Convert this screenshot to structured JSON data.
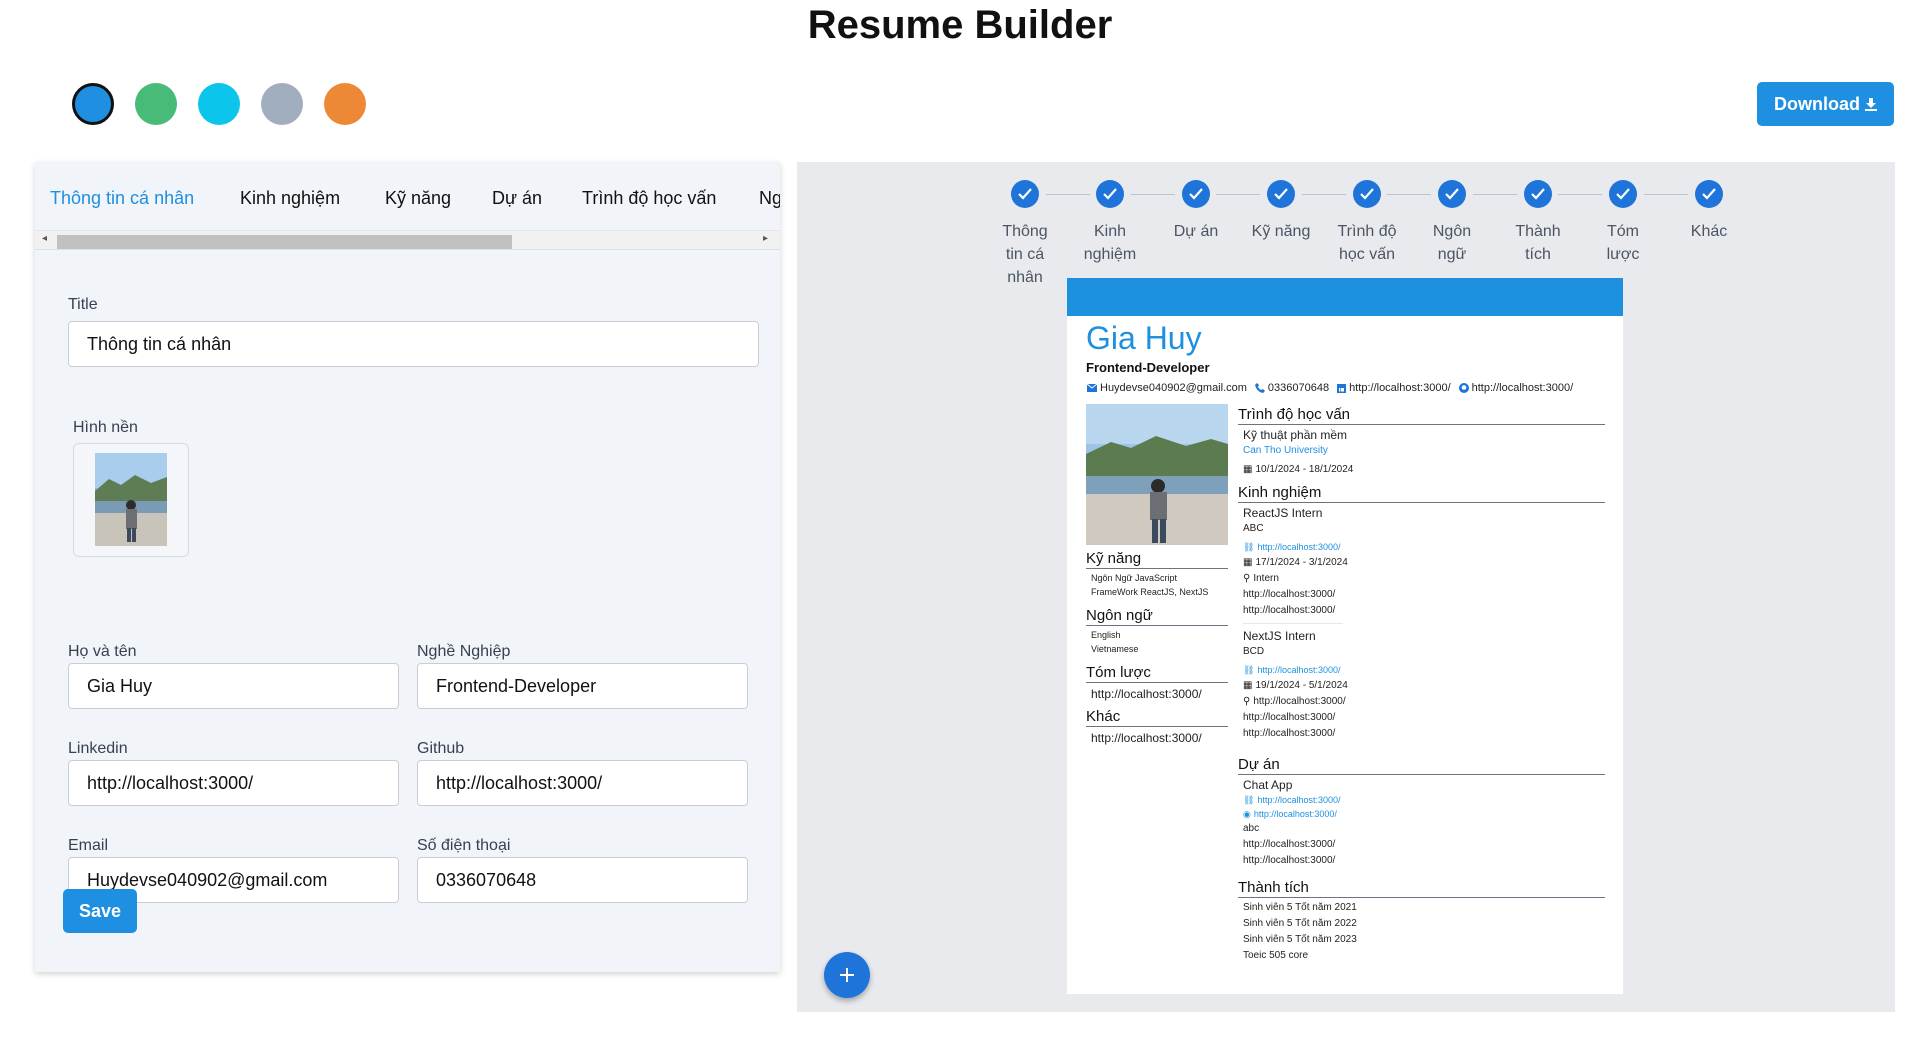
{
  "app": {
    "title": "Resume Builder",
    "download_label": "Download"
  },
  "colors": {
    "swatches": [
      "#1e8fe1",
      "#48bb78",
      "#0bc5ea",
      "#a0aec0",
      "#ed8936"
    ],
    "selected_swatch": "#1e8fe1",
    "accent": "#1e8fe1"
  },
  "tabs": [
    {
      "label": "Thông tin cá nhân",
      "active": true
    },
    {
      "label": "Kinh nghiệm",
      "active": false
    },
    {
      "label": "Kỹ năng",
      "active": false
    },
    {
      "label": "Dự án",
      "active": false
    },
    {
      "label": "Trình độ học vấn",
      "active": false
    },
    {
      "label": "Ng",
      "active": false
    }
  ],
  "form": {
    "title_label": "Title",
    "title_value": "Thông tin cá nhân",
    "background_label": "Hình nền",
    "fullname_label": "Họ và tên",
    "fullname_value": "Gia Huy",
    "job_label": "Nghề Nghiệp",
    "job_value": "Frontend-Developer",
    "linkedin_label": "Linkedin",
    "linkedin_value": "http://localhost:3000/",
    "github_label": "Github",
    "github_value": "http://localhost:3000/",
    "email_label": "Email",
    "email_value": "Huydevse040902@gmail.com",
    "phone_label": "Số điện thoại",
    "phone_value": "0336070648",
    "save_label": "Save"
  },
  "steps": [
    {
      "label": "Thông tin cá nhân"
    },
    {
      "label": "Kinh nghiệm"
    },
    {
      "label": "Dự án"
    },
    {
      "label": "Kỹ năng"
    },
    {
      "label": "Trình độ học vấn"
    },
    {
      "label": "Ngôn ngữ"
    },
    {
      "label": "Thành tích"
    },
    {
      "label": "Tóm lược"
    },
    {
      "label": "Khác"
    }
  ],
  "resume": {
    "name": "Gia Huy",
    "job": "Frontend-Developer",
    "email": "Huydevse040902@gmail.com",
    "phone": "0336070648",
    "linkedin": "http://localhost:3000/",
    "github": "http://localhost:3000/",
    "skills_title": "Kỹ năng",
    "skills": [
      "Ngôn Ngữ JavaScript",
      "FrameWork ReactJS, NextJS"
    ],
    "languages_title": "Ngôn ngữ",
    "languages": [
      "English",
      "Vietnamese"
    ],
    "summary_title": "Tóm lược",
    "summary": "http://localhost:3000/",
    "other_title": "Khác",
    "other": "http://localhost:3000/",
    "education_title": "Trình độ học vấn",
    "education": {
      "major": "Kỹ thuật phần mềm",
      "school": "Can Tho University",
      "dates": "10/1/2024 - 18/1/2024"
    },
    "experience_title": "Kinh nghiệm",
    "experiences": [
      {
        "role": "ReactJS Intern",
        "company": "ABC",
        "link": "http://localhost:3000/",
        "dates": "17/1/2024 - 3/1/2024",
        "location": "Intern",
        "line1": "http://localhost:3000/",
        "line2": "http://localhost:3000/"
      },
      {
        "role": "NextJS Intern",
        "company": "BCD",
        "link": "http://localhost:3000/",
        "dates": "19/1/2024 - 5/1/2024",
        "location": "http://localhost:3000/",
        "line1": "http://localhost:3000/",
        "line2": "http://localhost:3000/"
      }
    ],
    "projects_title": "Dự án",
    "project": {
      "name": "Chat App",
      "link1": "http://localhost:3000/",
      "link2": "http://localhost:3000/",
      "desc": "abc",
      "line1": "http://localhost:3000/",
      "line2": "http://localhost:3000/"
    },
    "achievements_title": "Thành tích",
    "achievements": [
      "Sinh viên 5 Tốt năm 2021",
      "Sinh viên 5 Tốt năm 2022",
      "Sinh viên 5 Tốt năm 2023",
      "Toeic 505 core"
    ]
  }
}
